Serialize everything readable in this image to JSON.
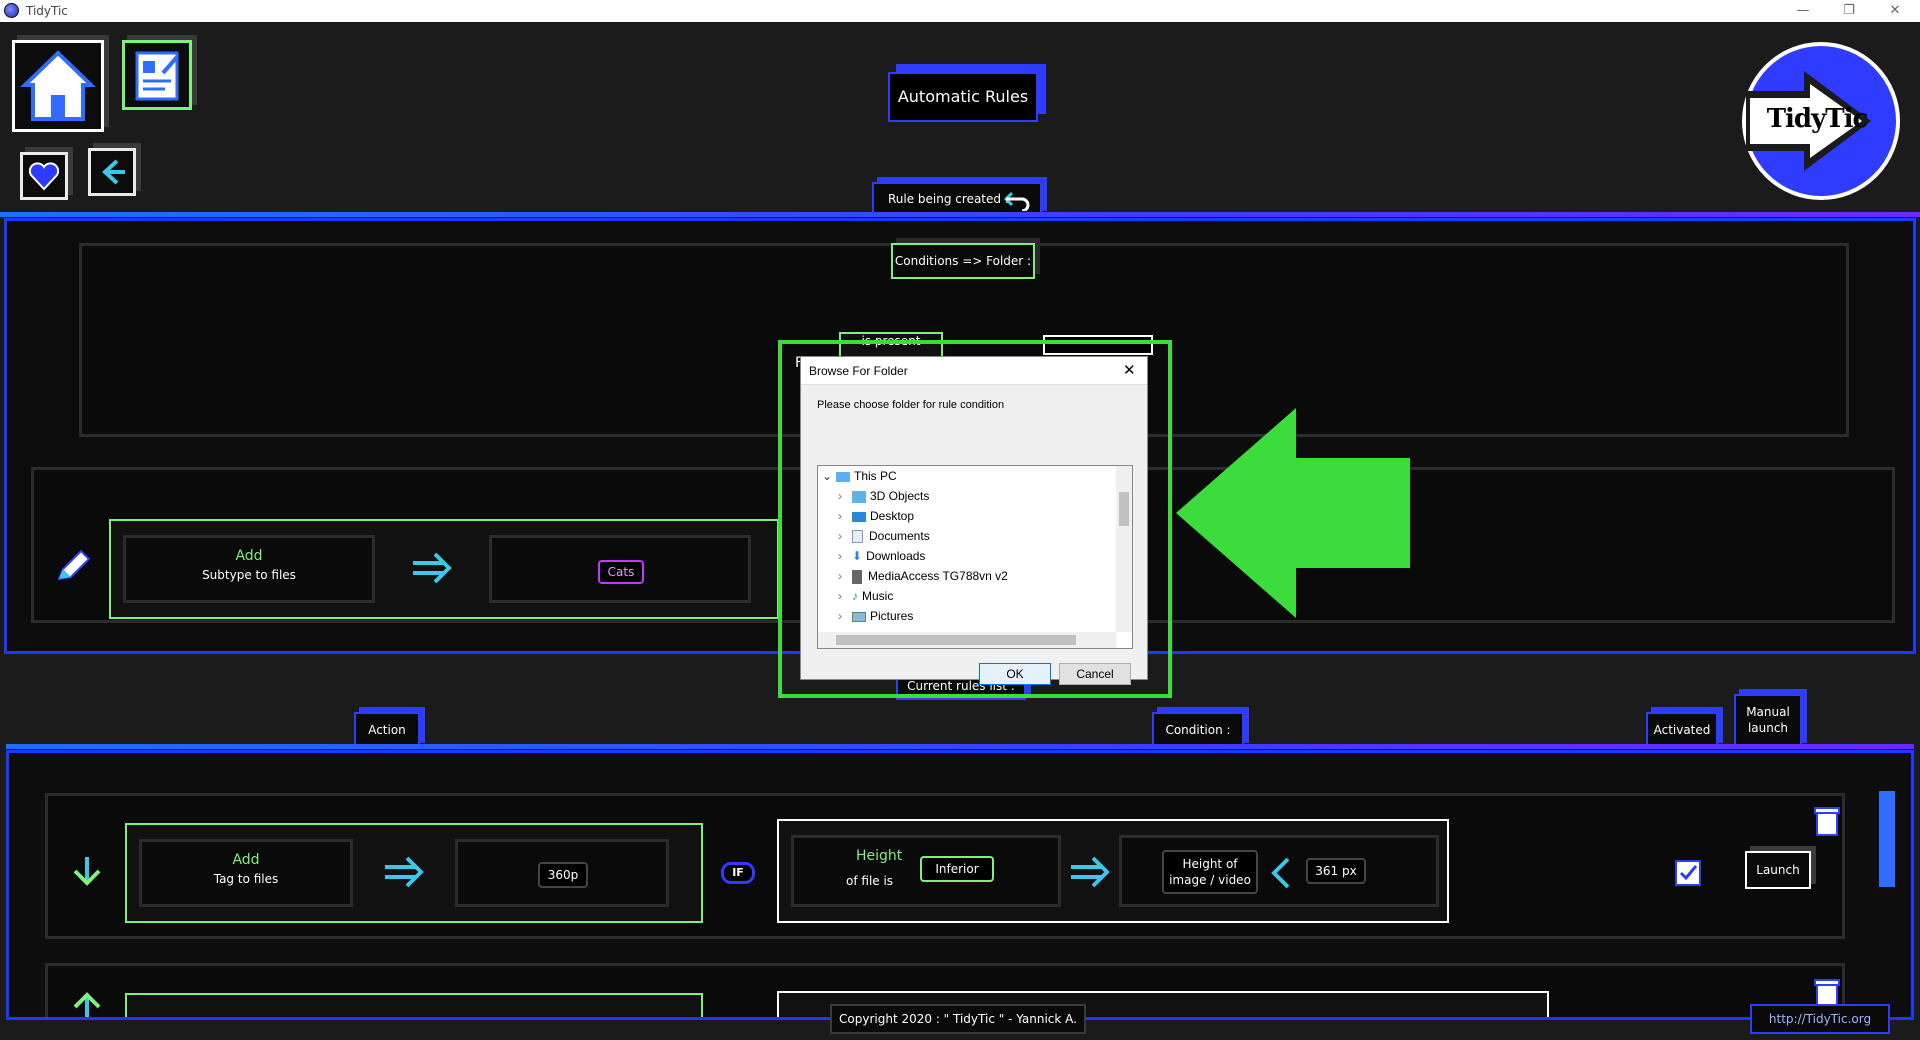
{
  "window": {
    "title": "TidyTic",
    "controls": [
      "—",
      "❐",
      "✕"
    ]
  },
  "header": {
    "title": "Automatic Rules",
    "logo_text": "TidyTic"
  },
  "creation": {
    "tab_label": "Rule being created :",
    "conditions_label": "Conditions => Folder :",
    "condition_peek": "is present",
    "condition_peek_left": "F",
    "action": {
      "verb": "Add",
      "desc": "Subtype to files",
      "value": "Cats"
    }
  },
  "rules_list": {
    "tab_label": "Current rules list :",
    "col_action": "Action",
    "col_condition": "Condition :",
    "col_activated": "Activated",
    "col_manual": "Manual launch",
    "rule1": {
      "action_verb": "Add",
      "action_desc": "Tag to files",
      "action_value": "360p",
      "if_label": "IF",
      "cond_title": "Height",
      "cond_sub": "of file is",
      "cond_op": "Inferior",
      "cond_target": "Height of image / video",
      "cond_value": "361 px",
      "launch": "Launch"
    }
  },
  "footer": {
    "copyright": "Copyright 2020 : \" TidyTic \" - Yannick A.",
    "link": "http://TidyTic.org"
  },
  "dialog": {
    "title": "Browse For Folder",
    "prompt": "Please choose folder for rule condition",
    "root": "This PC",
    "items": [
      "3D Objects",
      "Desktop",
      "Documents",
      "Downloads",
      "MediaAccess TG788vn v2",
      "Music",
      "Pictures"
    ],
    "ok": "OK",
    "cancel": "Cancel"
  },
  "colors": {
    "accent_blue": "#2f3cff",
    "accent_green": "#3ddc3d",
    "accent_cyan": "#3ec6e8",
    "accent_purple": "#6a2aff"
  }
}
